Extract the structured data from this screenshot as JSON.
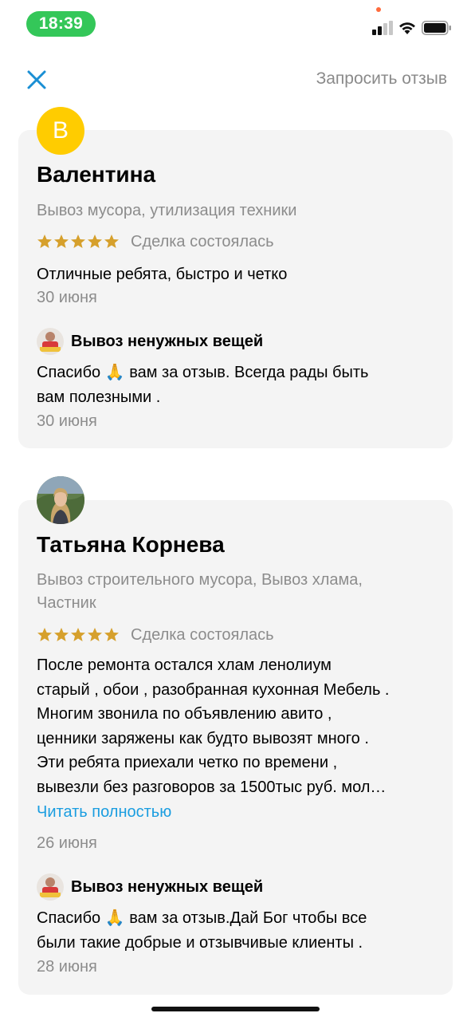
{
  "status_bar": {
    "time": "18:39"
  },
  "header": {
    "request_review": "Запросить отзыв"
  },
  "reviews": [
    {
      "avatar_letter": "В",
      "name": "Валентина",
      "category_lines": [
        "Вывоз мусора, утилизация техники"
      ],
      "rating": 5,
      "deal_status": "Сделка состоялась",
      "text_lines": [
        "Отличные ребята, быстро и четко"
      ],
      "date": "30 июня",
      "reply": {
        "author": "Вывоз ненужных вещей",
        "text_line1_before": "Спасибо",
        "text_line1_after": "вам за отзыв. Всегда рады быть",
        "text_line2": "вам полезными .",
        "date": "30 июня"
      }
    },
    {
      "name": "Татьяна Корнева",
      "category_lines": [
        "Вывоз строительного мусора, Вывоз хлама,",
        "Частник"
      ],
      "rating": 5,
      "deal_status": "Сделка состоялась",
      "text_lines": [
        "После ремонта остался хлам ленолиум",
        "старый , обои , разобранная кухонная Мебель .",
        "Многим звонила по объявлению авито ,",
        "ценники заряжены как будто вывозят много .",
        "Эти ребята приехали четко по времени ,",
        "вывезли без разговоров за 1500тыс руб. мол…"
      ],
      "read_more": "Читать полностью",
      "date": "26 июня",
      "reply": {
        "author": "Вывоз ненужных вещей",
        "text_line1_before": "Спасибо",
        "text_line1_after": "вам за отзыв.Дай Бог чтобы все",
        "text_line2": "были такие добрые и отзывчивые клиенты .",
        "date": "28 июня"
      }
    }
  ],
  "colors": {
    "star": "#d6a02c",
    "link": "#1a9de0",
    "avatar_letter_bg": "#ffcc00",
    "time_pill": "#34c759"
  },
  "icons": [
    "close-icon",
    "star-icon",
    "pray-emoji-icon",
    "wifi-icon",
    "signal-icon",
    "battery-icon"
  ]
}
